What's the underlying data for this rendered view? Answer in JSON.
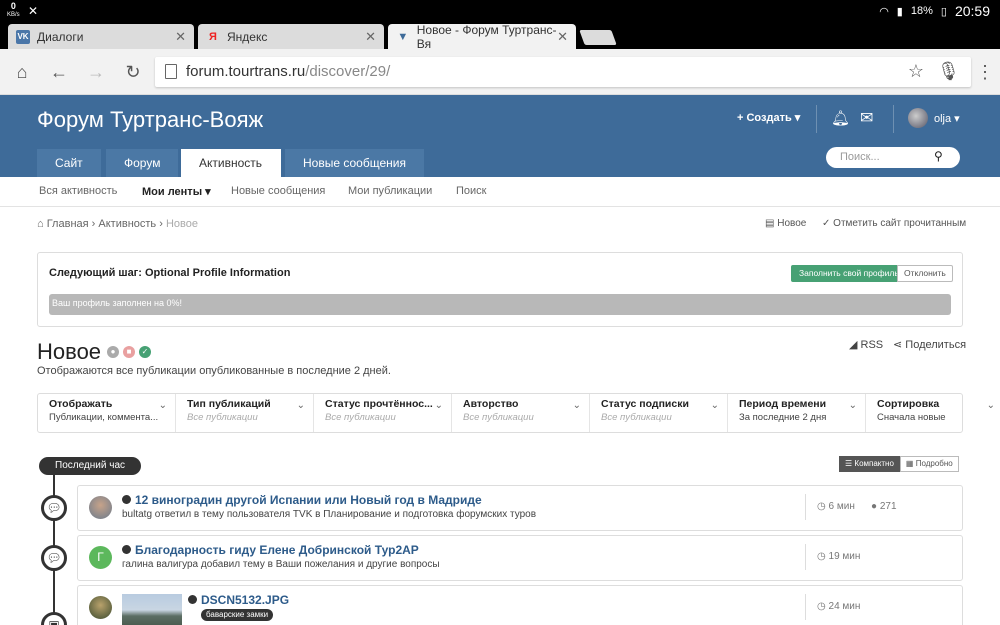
{
  "statusbar": {
    "kbs": "0",
    "kbs_unit": "KB/s",
    "battery": "18%",
    "time": "20:59"
  },
  "browser": {
    "tabs": [
      {
        "title": "Диалоги",
        "icon": "vk-icon"
      },
      {
        "title": "Яндекс",
        "icon": "yandex-icon"
      },
      {
        "title": "Новое - Форум Туртранс-Вя",
        "icon": "forum-icon"
      }
    ],
    "url_host": "forum.tourtrans.ru",
    "url_path": "/discover/29/"
  },
  "header": {
    "site_title": "Форум Туртранс-Вояж",
    "create_label": "+ Создать ▾",
    "username": "olja ▾",
    "nav": [
      "Сайт",
      "Форум",
      "Активность",
      "Новые сообщения"
    ],
    "search_placeholder": "Поиск..."
  },
  "subnav": [
    "Вся активность",
    "Мои ленты ▾",
    "Новые сообщения",
    "Мои публикации",
    "Поиск"
  ],
  "breadcrumb": {
    "home": "Главная",
    "activity": "Активность",
    "current": "Новое"
  },
  "breadcrumb_right": {
    "new": "Новое",
    "mark_read": "Отметить сайт прочитанным"
  },
  "step": {
    "title": "Следующий шаг: Optional Profile Information",
    "fill_label": "Заполнить свой профиль",
    "decline_label": "Отклонить",
    "progress_text": "Ваш профиль заполнен на 0%!",
    "progress": 0
  },
  "page": {
    "title": "Новое",
    "description": "Отображаются все публикации опубликованные в последние 2 дней.",
    "rss": "RSS",
    "share": "Поделиться"
  },
  "filters": [
    {
      "label": "Отображать",
      "value": "Публикации, коммента...",
      "placeholder": false
    },
    {
      "label": "Тип публикаций",
      "value": "Все публикации",
      "placeholder": true
    },
    {
      "label": "Статус прочтённос...",
      "value": "Все публикации",
      "placeholder": true
    },
    {
      "label": "Авторство",
      "value": "Все публикации",
      "placeholder": true
    },
    {
      "label": "Статус подписки",
      "value": "Все публикации",
      "placeholder": true
    },
    {
      "label": "Период времени",
      "value": "За последние 2 дня",
      "placeholder": false
    },
    {
      "label": "Сортировка",
      "value": "Сначала новые",
      "placeholder": false
    }
  ],
  "timeline": {
    "label": "Последний час",
    "compact": "Компактно",
    "detailed": "Подробно"
  },
  "items": [
    {
      "title": "12 виноградин другой Испании или Новый год в Мадриде",
      "sub": "bultatg ответил в тему пользователя TVK в Планирование и подготовка форумских туров",
      "time": "6 мин",
      "comments": "271"
    },
    {
      "title": "Благодарность гиду Елене Добринской Тур2АР",
      "sub": "галина валигура добавил тему в Ваши пожелания и другие вопросы",
      "time": "19 мин",
      "avatar_letter": "Г"
    },
    {
      "title": "DSCN5132.JPG",
      "tag": "баварские замки",
      "time": "24 мин"
    }
  ],
  "colors": {
    "header": "#3e6b99",
    "accent_green": "#47a174",
    "link": "#2d5b8a"
  }
}
